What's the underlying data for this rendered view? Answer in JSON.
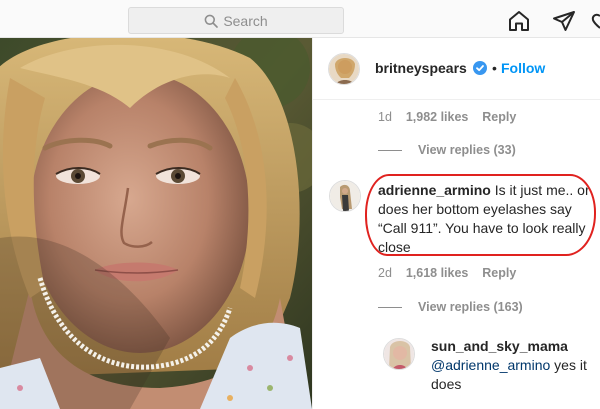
{
  "topbar": {
    "search_placeholder": "Search",
    "icons": [
      "search-icon",
      "home-icon",
      "direct-send-icon"
    ]
  },
  "post": {
    "author": "britneyspears",
    "follow_label": "Follow",
    "separator": "•"
  },
  "comments": [
    {
      "meta_time": "1d",
      "meta_likes": "1,982 likes",
      "meta_reply": "Reply",
      "view_replies": "View replies (33)"
    },
    {
      "user": "adrienne_armino",
      "text": "Is it just me.. or does her bottom eyelashes say “Call 911”. You have to look really close",
      "meta_time": "2d",
      "meta_likes": "1,618 likes",
      "meta_reply": "Reply",
      "view_replies": "View replies (163)"
    },
    {
      "user": "sun_and_sky_mama",
      "mention": "@adrienne_armino",
      "text": " yes it does"
    }
  ],
  "colors": {
    "follow_blue": "#0095f6",
    "highlight_red": "#e0221f",
    "muted_gray": "#8e8e8e",
    "mention": "#00376b"
  }
}
